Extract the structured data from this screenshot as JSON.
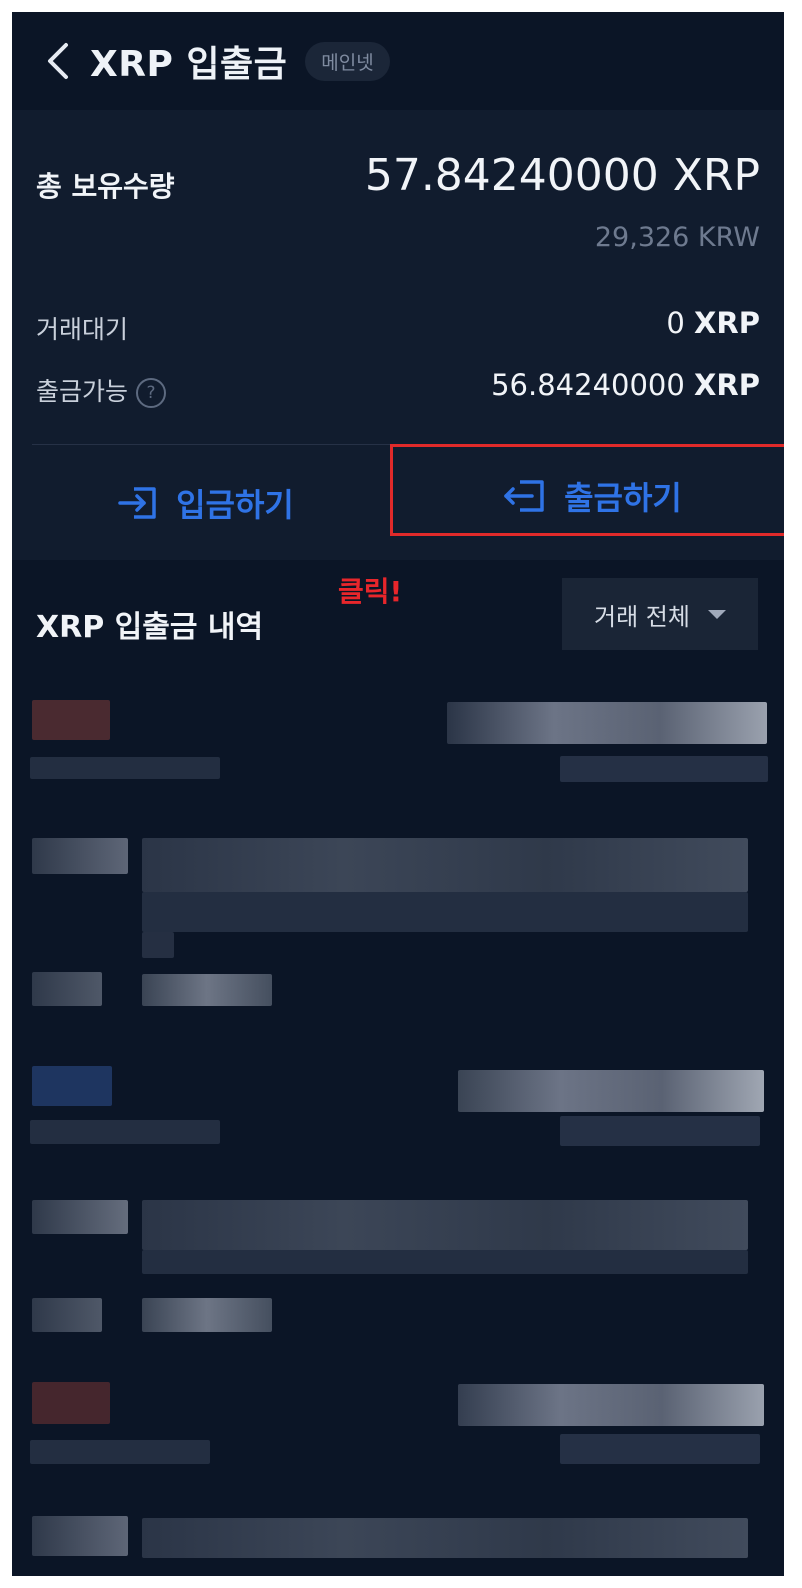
{
  "header": {
    "title": "XRP 입출금",
    "network_badge": "메인넷",
    "back_icon": "chevron-left-icon"
  },
  "summary": {
    "total_label": "총 보유수량",
    "total_amount": "57.84240000 XRP",
    "total_krw": "29,326 KRW",
    "pending_label": "거래대기",
    "pending_number": "0",
    "pending_unit": "XRP",
    "available_label": "출금가능",
    "available_help_glyph": "?",
    "available_number": "56.84240000",
    "available_unit": "XRP"
  },
  "actions": {
    "deposit_label": "입금하기",
    "withdraw_label": "출금하기",
    "accent_color": "#2f73e6"
  },
  "annotation": {
    "click_text": "클릭!",
    "highlight_color": "#e02a2a"
  },
  "history": {
    "title": "XRP 입출금 내역",
    "filter_label": "거래 전체"
  }
}
